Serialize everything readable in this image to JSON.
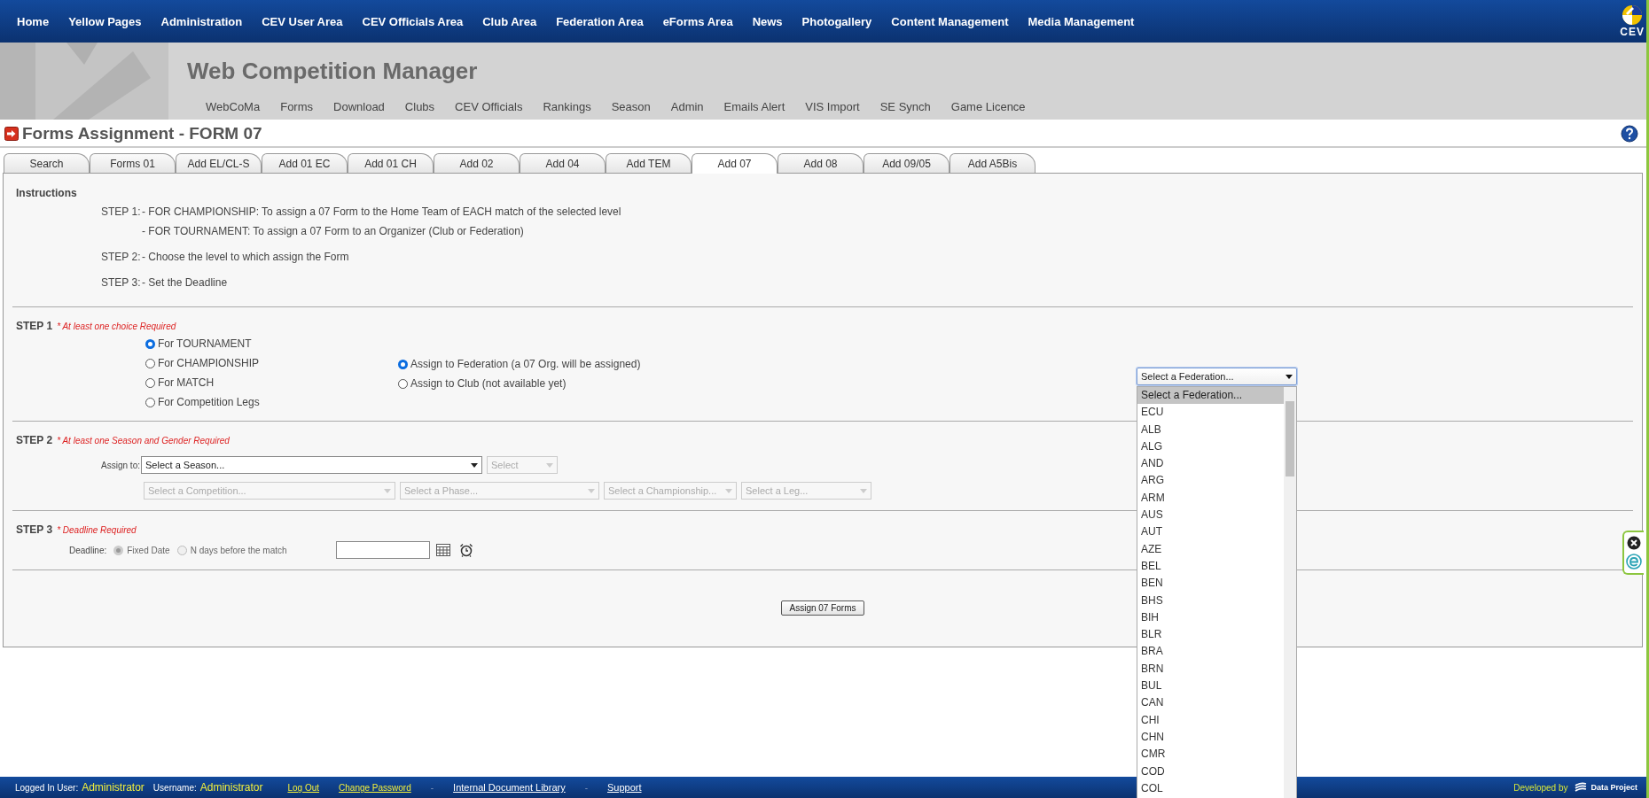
{
  "top_nav": {
    "items": [
      "Home",
      "Yellow Pages",
      "Administration",
      "CEV User Area",
      "CEV Officials Area",
      "Club Area",
      "Federation Area",
      "eForms Area",
      "News",
      "Photogallery",
      "Content Management",
      "Media Management"
    ],
    "logo_text": "CEV"
  },
  "header": {
    "title": "Web Competition Manager",
    "menu": [
      "WebCoMa",
      "Forms",
      "Download",
      "Clubs",
      "CEV Officials",
      "Rankings",
      "Season",
      "Admin",
      "Emails Alert",
      "VIS Import",
      "SE Synch",
      "Game Licence"
    ]
  },
  "page_title": "Forms Assignment - FORM 07",
  "tabs": [
    {
      "label": "Search",
      "selected": false
    },
    {
      "label": "Forms 01",
      "selected": false
    },
    {
      "label": "Add EL/CL-S",
      "selected": false
    },
    {
      "label": "Add 01 EC",
      "selected": false
    },
    {
      "label": "Add 01 CH",
      "selected": false
    },
    {
      "label": "Add 02",
      "selected": false
    },
    {
      "label": "Add 04",
      "selected": false
    },
    {
      "label": "Add TEM",
      "selected": false
    },
    {
      "label": "Add 07",
      "selected": true
    },
    {
      "label": "Add 08",
      "selected": false
    },
    {
      "label": "Add 09/05",
      "selected": false
    },
    {
      "label": "Add A5Bis",
      "selected": false
    }
  ],
  "instructions": {
    "title": "Instructions",
    "steps": [
      {
        "label": "STEP 1:",
        "lines": [
          "- FOR CHAMPIONSHIP: To assign a 07 Form to the Home Team of EACH match of the selected level",
          "- FOR TOURNAMENT: To assign a 07 Form to an Organizer (Club or Federation)"
        ]
      },
      {
        "label": "STEP 2:",
        "lines": [
          "- Choose the level to which assign the Form"
        ]
      },
      {
        "label": "STEP 3:",
        "lines": [
          "- Set the Deadline"
        ]
      }
    ]
  },
  "step1": {
    "title": "STEP 1",
    "note": "* At least one choice Required",
    "levels": [
      {
        "label": "For TOURNAMENT",
        "selected": true
      },
      {
        "label": "For CHAMPIONSHIP",
        "selected": false
      },
      {
        "label": "For MATCH",
        "selected": false
      },
      {
        "label": "For Competition Legs",
        "selected": false
      }
    ],
    "assign": [
      {
        "label": "Assign to Federation (a 07 Org. will be assigned)",
        "selected": true
      },
      {
        "label": "Assign to Club (not available yet)",
        "selected": false
      }
    ],
    "federation_select": {
      "value": "Select a Federation...",
      "expanded": true,
      "options": [
        {
          "label": "Select a Federation...",
          "selected": true
        },
        {
          "label": "ECU",
          "selected": false
        },
        {
          "label": "ALB",
          "selected": false
        },
        {
          "label": "ALG",
          "selected": false
        },
        {
          "label": "AND",
          "selected": false
        },
        {
          "label": "ARG",
          "selected": false
        },
        {
          "label": "ARM",
          "selected": false
        },
        {
          "label": "AUS",
          "selected": false
        },
        {
          "label": "AUT",
          "selected": false
        },
        {
          "label": "AZE",
          "selected": false
        },
        {
          "label": "BEL",
          "selected": false
        },
        {
          "label": "BEN",
          "selected": false
        },
        {
          "label": "BHS",
          "selected": false
        },
        {
          "label": "BIH",
          "selected": false
        },
        {
          "label": "BLR",
          "selected": false
        },
        {
          "label": "BRA",
          "selected": false
        },
        {
          "label": "BRN",
          "selected": false
        },
        {
          "label": "BUL",
          "selected": false
        },
        {
          "label": "CAN",
          "selected": false
        },
        {
          "label": "CHI",
          "selected": false
        },
        {
          "label": "CHN",
          "selected": false
        },
        {
          "label": "CMR",
          "selected": false
        },
        {
          "label": "COD",
          "selected": false
        },
        {
          "label": "COL",
          "selected": false
        }
      ]
    }
  },
  "step2": {
    "title": "STEP 2",
    "note": "* At least one Season and Gender Required",
    "assign_label": "Assign to:",
    "selects": [
      {
        "value": "Select a Season...",
        "disabled": false
      },
      {
        "value": "Select",
        "disabled": true
      }
    ],
    "filters": [
      {
        "value": "Select a Competition...",
        "disabled": true
      },
      {
        "value": "Select a Phase...",
        "disabled": true
      },
      {
        "value": "Select a Championship...",
        "disabled": true
      },
      {
        "value": "Select a Leg...",
        "disabled": true
      }
    ]
  },
  "step3": {
    "title": "STEP 3",
    "note": "* Deadline Required",
    "deadline_label": "Deadline:",
    "options": [
      {
        "label": "Fixed Date",
        "selected": true,
        "disabled": true
      },
      {
        "label": "N days before the match",
        "selected": false,
        "disabled": true
      }
    ]
  },
  "submit": "Assign 07 Forms",
  "footer": {
    "user_label": "Logged In User:",
    "user": "Administrator",
    "username_label": "Username:",
    "username": "Administrator",
    "links": [
      {
        "kind": "highlight",
        "text": "Log Out"
      },
      {
        "kind": "highlight",
        "text": "Change Password"
      },
      {
        "kind": "separator",
        "text": "-"
      },
      {
        "kind": "plain",
        "text": "Internal Document Library"
      },
      {
        "kind": "separator",
        "text": "-"
      },
      {
        "kind": "plain",
        "text": "Support"
      }
    ],
    "developed_by": "Developed by",
    "brand": "Data Project"
  }
}
